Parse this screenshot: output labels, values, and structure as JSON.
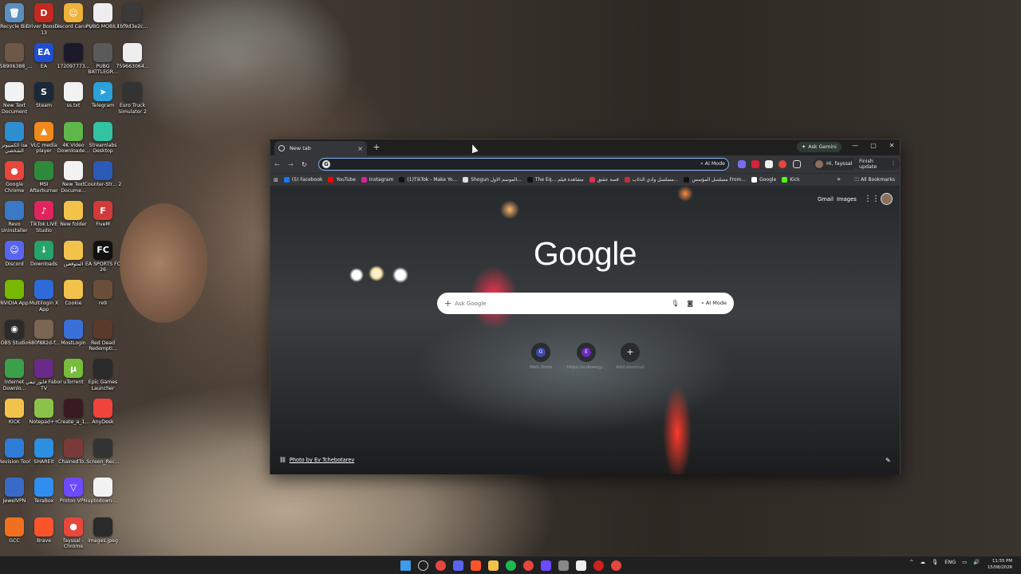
{
  "desktop": {
    "icons": [
      {
        "label": "Recycle Bin",
        "color": "#5a8fbf",
        "glyph": "🗑"
      },
      {
        "label": "Driver Booster 13",
        "color": "#c22a1f",
        "glyph": "D"
      },
      {
        "label": "Discord Canary",
        "color": "#f0b23a",
        "glyph": "☺"
      },
      {
        "label": "PUBG MOBILE",
        "color": "#eeeeee",
        "glyph": ""
      },
      {
        "label": "1bf9d3e2c...",
        "color": "#3a3a3a",
        "glyph": ""
      },
      {
        "label": "558906388_...",
        "color": "#6d5847",
        "glyph": ""
      },
      {
        "label": "EA",
        "color": "#1f4fd1",
        "glyph": "EA"
      },
      {
        "label": "172097773...",
        "color": "#1a1a2a",
        "glyph": ""
      },
      {
        "label": "PUBG BATTLEGR...",
        "color": "#5a5a5a",
        "glyph": ""
      },
      {
        "label": "759663064...",
        "color": "#eeeeee",
        "glyph": ""
      },
      {
        "label": "New Text Document",
        "color": "#f2f2f2",
        "glyph": ""
      },
      {
        "label": "Steam",
        "color": "#1b2838",
        "glyph": "S"
      },
      {
        "label": "ss.txt",
        "color": "#f2f2f2",
        "glyph": ""
      },
      {
        "label": "Telegram",
        "color": "#2aa1da",
        "glyph": "➤"
      },
      {
        "label": "Euro Truck Simulator 2",
        "color": "#333333",
        "glyph": ""
      },
      {
        "label": "هذا الكمبيوتر الشخصي",
        "color": "#2e8fd0",
        "glyph": ""
      },
      {
        "label": "VLC media player",
        "color": "#f08a1c",
        "glyph": "▲"
      },
      {
        "label": "4K Video Downloade...",
        "color": "#5fb64b",
        "glyph": ""
      },
      {
        "label": "Streamlabs Desktop",
        "color": "#31c3a2",
        "glyph": ""
      },
      {
        "label": "Google Chrome",
        "color": "#e8453c",
        "glyph": "●"
      },
      {
        "label": "MSI Afterburner",
        "color": "#2d8a3a",
        "glyph": ""
      },
      {
        "label": "New Text Docume...",
        "color": "#f2f2f2",
        "glyph": ""
      },
      {
        "label": "Counter-Str... 2",
        "color": "#2c5ab8",
        "glyph": ""
      },
      {
        "label": "Revo Uninstaller",
        "color": "#3a78c8",
        "glyph": ""
      },
      {
        "label": "TikTok LIVE Studio",
        "color": "#e0245e",
        "glyph": "♪"
      },
      {
        "label": "New folder",
        "color": "#f3c24a",
        "glyph": ""
      },
      {
        "label": "FiveM",
        "color": "#d23a3a",
        "glyph": "F"
      },
      {
        "label": "Discord",
        "color": "#5865f2",
        "glyph": "☺"
      },
      {
        "label": "Downloads",
        "color": "#25a36b",
        "glyph": "↓"
      },
      {
        "label": "المتوقعين",
        "color": "#f3c24a",
        "glyph": ""
      },
      {
        "label": "EA SPORTS FC 26",
        "color": "#111111",
        "glyph": "FC"
      },
      {
        "label": "NVIDIA App",
        "color": "#76b900",
        "glyph": ""
      },
      {
        "label": "Multilogin X App",
        "color": "#2f6bd8",
        "glyph": ""
      },
      {
        "label": "Cookie",
        "color": "#f3c24a",
        "glyph": ""
      },
      {
        "label": "re9",
        "color": "#6b4e3a",
        "glyph": ""
      },
      {
        "label": "OBS Studio",
        "color": "#2b2b2b",
        "glyph": "◉"
      },
      {
        "label": "680f882d-f...",
        "color": "#7a6652",
        "glyph": ""
      },
      {
        "label": "MostLogin",
        "color": "#3a6fd8",
        "glyph": ""
      },
      {
        "label": "Red Dead Redempti...",
        "color": "#5a3a2a",
        "glyph": ""
      },
      {
        "label": "Internet Downlo...",
        "color": "#3aa04a",
        "glyph": ""
      },
      {
        "label": "فابور تيفي Fabor TV",
        "color": "#6a2a8a",
        "glyph": ""
      },
      {
        "label": "uTorrent",
        "color": "#78bc3c",
        "glyph": "µ"
      },
      {
        "label": "Epic Games Launcher",
        "color": "#2a2a2a",
        "glyph": ""
      },
      {
        "label": "KICK",
        "color": "#f3c24a",
        "glyph": ""
      },
      {
        "label": "Notepad++",
        "color": "#8bc34a",
        "glyph": ""
      },
      {
        "label": "Create_a_1...",
        "color": "#3a1a22",
        "glyph": ""
      },
      {
        "label": "AnyDesk",
        "color": "#ef443b",
        "glyph": ""
      },
      {
        "label": "Revision Tool",
        "color": "#2d7cd6",
        "glyph": ""
      },
      {
        "label": "SHAREit",
        "color": "#2d8fe0",
        "glyph": ""
      },
      {
        "label": "ChainedTo...",
        "color": "#7a3a3a",
        "glyph": ""
      },
      {
        "label": "Screen_Rec...",
        "color": "#333333",
        "glyph": ""
      },
      {
        "label": "JewelVPN",
        "color": "#3a6ac8",
        "glyph": ""
      },
      {
        "label": "TeraBox",
        "color": "#2f8ef0",
        "glyph": ""
      },
      {
        "label": "Proton VPN",
        "color": "#6d4aff",
        "glyph": "▽"
      },
      {
        "label": "uptodown-...",
        "color": "#f2f2f2",
        "glyph": ""
      },
      {
        "label": "GCC",
        "color": "#f07020",
        "glyph": ""
      },
      {
        "label": "Brave",
        "color": "#fb542b",
        "glyph": ""
      },
      {
        "label": "fayssal - Chrome",
        "color": "#e8453c",
        "glyph": "●"
      },
      {
        "label": "images.jpeg",
        "color": "#2a2a2a",
        "glyph": ""
      }
    ]
  },
  "browser": {
    "tab_title": "New tab",
    "new_tab_glyph": "+",
    "tab_close_glyph": "×",
    "ask_gemini": "Ask Gemini",
    "minimize_glyph": "—",
    "maximize_glyph": "▢",
    "close_glyph": "✕",
    "back_glyph": "←",
    "forward_glyph": "→",
    "reload_glyph": "↻",
    "omnibox_value": "",
    "omnibox_g": "G",
    "omnibox_aimode": "AI Mode",
    "profile_name": "Hi, fayssal",
    "finish_update": "Finish update",
    "bookmarks": [
      {
        "label": "(5) Facebook",
        "color": "#1877f2"
      },
      {
        "label": "YouTube",
        "color": "#ff0000"
      },
      {
        "label": "Instagram",
        "color": "#d6249f"
      },
      {
        "label": "(1)TikTok - Make Yo...",
        "color": "#111111"
      },
      {
        "label": "Shogun الموسم الاول...",
        "color": "#dddddd"
      },
      {
        "label": "The Eq... مشاهدة فيلم",
        "color": "#111111"
      },
      {
        "label": "قصة عشق",
        "color": "#e0304a"
      },
      {
        "label": "مسلسل وادي الذئاب...",
        "color": "#c0303a"
      },
      {
        "label": "مسلسل المؤسس From...",
        "color": "#111111"
      },
      {
        "label": "Google",
        "color": "#ffffff"
      },
      {
        "label": "Kick",
        "color": "#53fc18"
      }
    ],
    "bookmarks_more": "»",
    "all_bookmarks": "All Bookmarks",
    "ntp": {
      "gmail": "Gmail",
      "images": "Images",
      "apps_glyph": "⋮⋮",
      "logo": "Google",
      "search_placeholder": "Ask Google",
      "search_aimode": "AI Mode",
      "shortcuts": [
        {
          "initial": "G",
          "label": "Web Store",
          "color": "#3c4aa8"
        },
        {
          "initial": "E",
          "label": "https://v.deeegy...",
          "color": "#6a2ab8"
        },
        {
          "initial": "+",
          "label": "Add shortcut",
          "color": "#2a2c2e"
        }
      ],
      "photo_credit": "Photo by Ev Tchebotarev"
    }
  },
  "taskbar": {
    "items": [
      {
        "name": "start",
        "color": "#3d9be9"
      },
      {
        "name": "search",
        "color": "#cccccc"
      },
      {
        "name": "chrome",
        "color": "#e8453c"
      },
      {
        "name": "discord",
        "color": "#5865f2"
      },
      {
        "name": "brave",
        "color": "#fb542b"
      },
      {
        "name": "explorer",
        "color": "#f3c24a"
      },
      {
        "name": "spotify",
        "color": "#1db954"
      },
      {
        "name": "chrome-2",
        "color": "#e8453c"
      },
      {
        "name": "proton",
        "color": "#6d4aff"
      },
      {
        "name": "xbox",
        "color": "#888888"
      },
      {
        "name": "capcut",
        "color": "#eeeeee"
      },
      {
        "name": "msi",
        "color": "#d02020"
      },
      {
        "name": "chrome-3",
        "color": "#e8453c"
      }
    ],
    "lang": "ENG",
    "time": "11:55 PM",
    "date": "15/08/2026"
  }
}
